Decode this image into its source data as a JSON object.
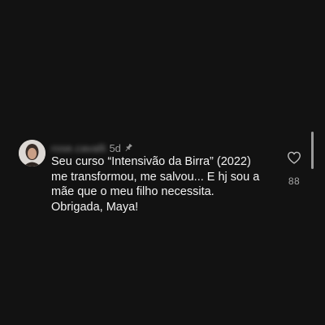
{
  "comment": {
    "username": "rose.cavalli",
    "age": "5d",
    "pinned_icon": "pin-icon",
    "text_lines": [
      "Seu curso “Intensivão da Birra” (2022)",
      "me transformou, me salvou... E hj sou a",
      "mãe que o meu filho necessita.",
      "Obrigada, Maya!"
    ],
    "like_icon": "heart-outline-icon",
    "like_count": "88"
  },
  "colors": {
    "background": "#121212",
    "text": "#f2f2f2",
    "secondary_text": "#9a9a9a",
    "scrollbar": "#9a9a9a"
  }
}
